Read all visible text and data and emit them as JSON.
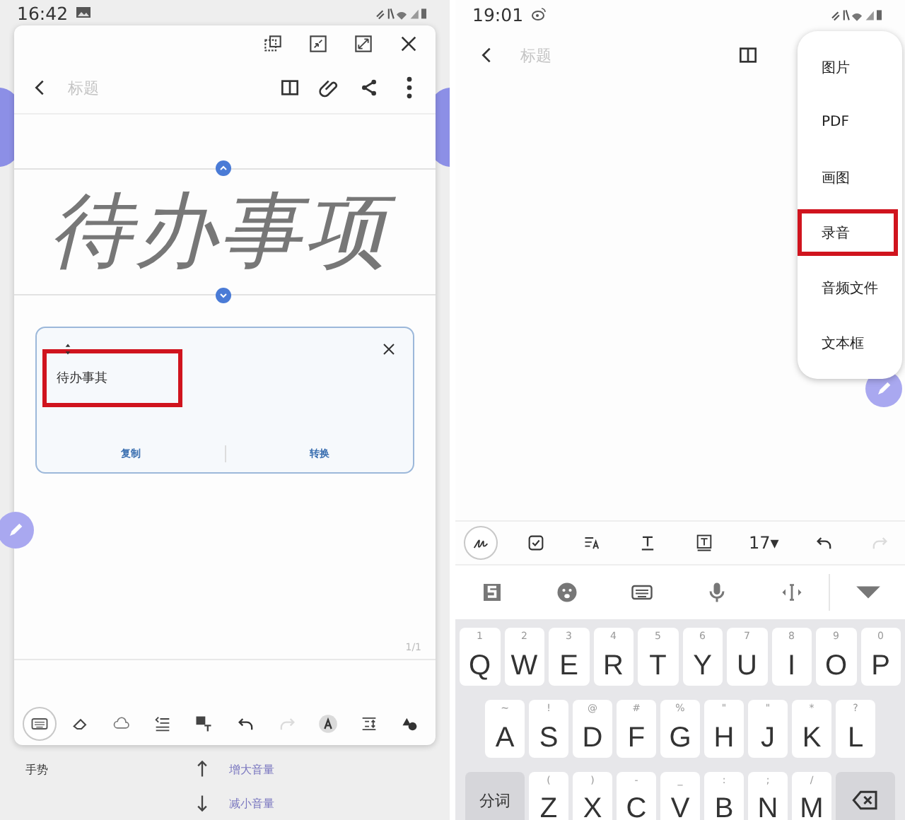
{
  "left_screen": {
    "status_bar": {
      "time": "16:42"
    },
    "header": {
      "title_placeholder": "标题"
    },
    "handwriting": "待办事项",
    "conversion_popup": {
      "result": "待办事其",
      "highlighted": true,
      "actions": [
        "复制",
        "转换"
      ]
    },
    "page_indicator": "1/1",
    "toolbar": [
      {
        "kind": "keyboard",
        "selected": true,
        "disabled": false
      },
      {
        "kind": "eraser",
        "selected": false,
        "disabled": false
      },
      {
        "kind": "cloud",
        "selected": false,
        "disabled": false
      },
      {
        "kind": "align",
        "selected": false,
        "disabled": false
      },
      {
        "kind": "image-text",
        "selected": false,
        "disabled": false
      },
      {
        "kind": "undo",
        "selected": false,
        "disabled": false
      },
      {
        "kind": "redo",
        "selected": false,
        "disabled": true
      },
      {
        "kind": "pen-style",
        "selected": false,
        "disabled": false
      },
      {
        "kind": "spacing",
        "selected": false,
        "disabled": false
      },
      {
        "kind": "shapes",
        "selected": false,
        "disabled": false
      }
    ],
    "gestures": {
      "label": "手势",
      "items": [
        {
          "kind": "up",
          "text": "增大音量"
        },
        {
          "kind": "down",
          "text": "减小音量"
        }
      ]
    }
  },
  "right_screen": {
    "status_bar": {
      "time": "19:01"
    },
    "header": {
      "title_placeholder": "标题"
    },
    "insert_menu": [
      {
        "label": "图片",
        "highlighted": false
      },
      {
        "label": "PDF",
        "highlighted": false
      },
      {
        "label": "画图",
        "highlighted": false
      },
      {
        "label": "录音",
        "highlighted": true
      },
      {
        "label": "音频文件",
        "highlighted": false
      },
      {
        "label": "文本框",
        "highlighted": false
      }
    ],
    "format_toolbar": {
      "handwriting_mode": {
        "on": true
      },
      "tools": [
        {
          "kind": "checklist",
          "disabled": false
        },
        {
          "kind": "text-format",
          "disabled": false
        },
        {
          "kind": "underline",
          "disabled": false
        },
        {
          "kind": "textbox",
          "disabled": false
        },
        {
          "kind": "font-size",
          "label": "17▾",
          "disabled": false
        },
        {
          "kind": "undo",
          "disabled": false
        },
        {
          "kind": "redo",
          "disabled": true
        }
      ]
    },
    "ime_bar": [
      {
        "kind": "ime-logo"
      },
      {
        "kind": "emoji"
      },
      {
        "kind": "keyboard"
      },
      {
        "kind": "microphone"
      },
      {
        "kind": "cursor"
      },
      {
        "kind": "collapse"
      }
    ],
    "keyboard": [
      [
        {
          "kind": "letter",
          "label": "Q",
          "hint": "1"
        },
        {
          "kind": "letter",
          "label": "W",
          "hint": "2"
        },
        {
          "kind": "letter",
          "label": "E",
          "hint": "3"
        },
        {
          "kind": "letter",
          "label": "R",
          "hint": "4"
        },
        {
          "kind": "letter",
          "label": "T",
          "hint": "5"
        },
        {
          "kind": "letter",
          "label": "Y",
          "hint": "6"
        },
        {
          "kind": "letter",
          "label": "U",
          "hint": "7"
        },
        {
          "kind": "letter",
          "label": "I",
          "hint": "8"
        },
        {
          "kind": "letter",
          "label": "O",
          "hint": "9"
        },
        {
          "kind": "letter",
          "label": "P",
          "hint": "0"
        }
      ],
      [
        {
          "kind": "letter",
          "label": "A",
          "hint": "~"
        },
        {
          "kind": "letter",
          "label": "S",
          "hint": "!"
        },
        {
          "kind": "letter",
          "label": "D",
          "hint": "@"
        },
        {
          "kind": "letter",
          "label": "F",
          "hint": "#"
        },
        {
          "kind": "letter",
          "label": "G",
          "hint": "%"
        },
        {
          "kind": "letter",
          "label": "H",
          "hint": "\""
        },
        {
          "kind": "letter",
          "label": "J",
          "hint": "\""
        },
        {
          "kind": "letter",
          "label": "K",
          "hint": "*"
        },
        {
          "kind": "letter",
          "label": "L",
          "hint": "?"
        }
      ],
      [
        {
          "kind": "function",
          "label": "分词"
        },
        {
          "kind": "letter",
          "label": "Z",
          "hint": "("
        },
        {
          "kind": "letter",
          "label": "X",
          "hint": ")"
        },
        {
          "kind": "letter",
          "label": "C",
          "hint": "-"
        },
        {
          "kind": "letter",
          "label": "V",
          "hint": "_"
        },
        {
          "kind": "letter",
          "label": "B",
          "hint": ":"
        },
        {
          "kind": "letter",
          "label": "N",
          "hint": ";"
        },
        {
          "kind": "letter",
          "label": "M",
          "hint": "/"
        },
        {
          "kind": "backspace"
        }
      ]
    ]
  }
}
